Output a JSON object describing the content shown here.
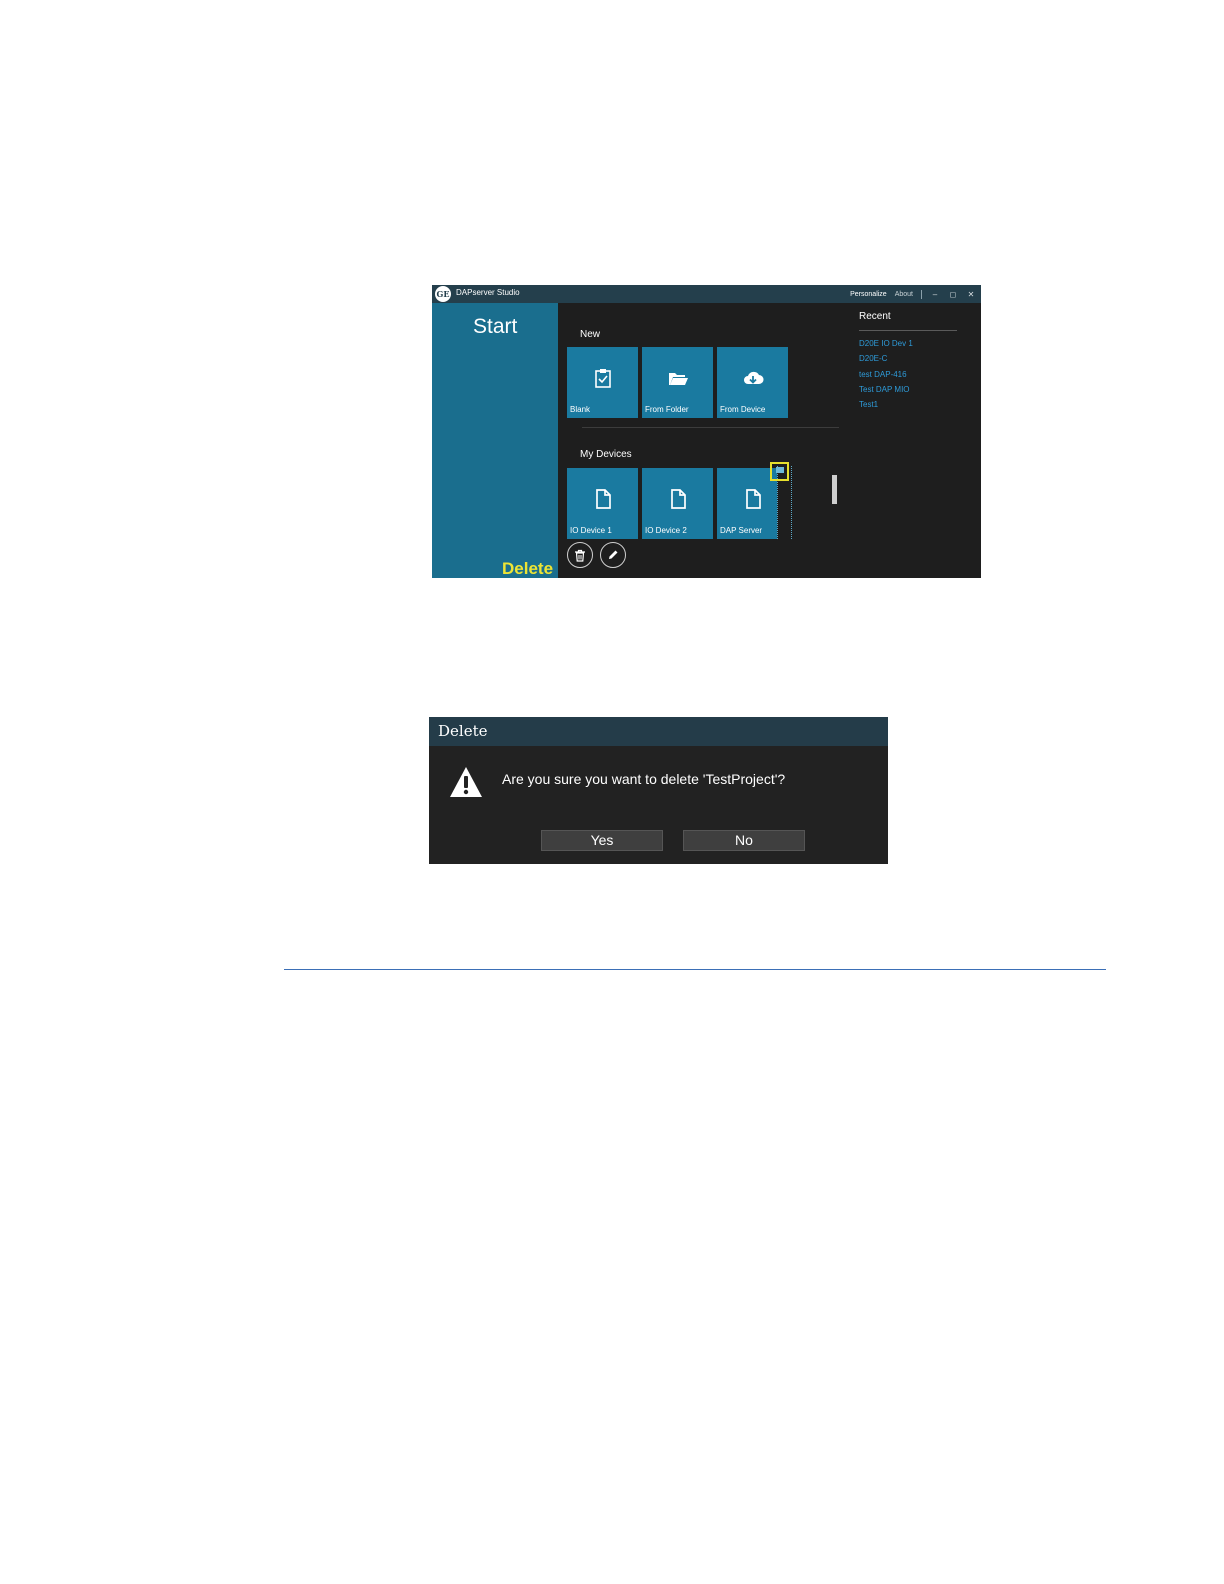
{
  "app": {
    "title": "DAPserver Studio",
    "logo_text": "GE",
    "toolbar": {
      "personalize": "Personalize",
      "about": "About"
    },
    "window_controls": [
      "minimize",
      "maximize",
      "close"
    ],
    "left_pane": {
      "heading": "Start",
      "command_label": "Delete"
    },
    "new_section": {
      "heading": "New",
      "tiles": [
        {
          "label": "Blank",
          "icon": "clipboard-icon"
        },
        {
          "label": "From Folder",
          "icon": "folder-open-icon"
        },
        {
          "label": "From Device",
          "icon": "cloud-download-icon"
        }
      ]
    },
    "devices_section": {
      "heading": "My Devices",
      "tiles": [
        {
          "label": "IO Device 1",
          "icon": "document-icon"
        },
        {
          "label": "IO Device 2",
          "icon": "document-icon"
        },
        {
          "label": "DAP Server",
          "icon": "document-icon"
        }
      ]
    },
    "recent": {
      "heading": "Recent",
      "items": [
        "D20E IO Dev 1",
        "D20E-C",
        "test DAP-416",
        "Test DAP MIO",
        "Test1"
      ]
    },
    "colors": {
      "accent": "#1a6e8e",
      "tile": "#1a7aa0",
      "highlight": "#ede435",
      "link": "#2e9bd9"
    }
  },
  "dialog": {
    "title": "Delete",
    "message": "Are you sure you want to delete 'TestProject'?",
    "icon": "warning-icon",
    "buttons": {
      "yes": "Yes",
      "no": "No"
    }
  }
}
